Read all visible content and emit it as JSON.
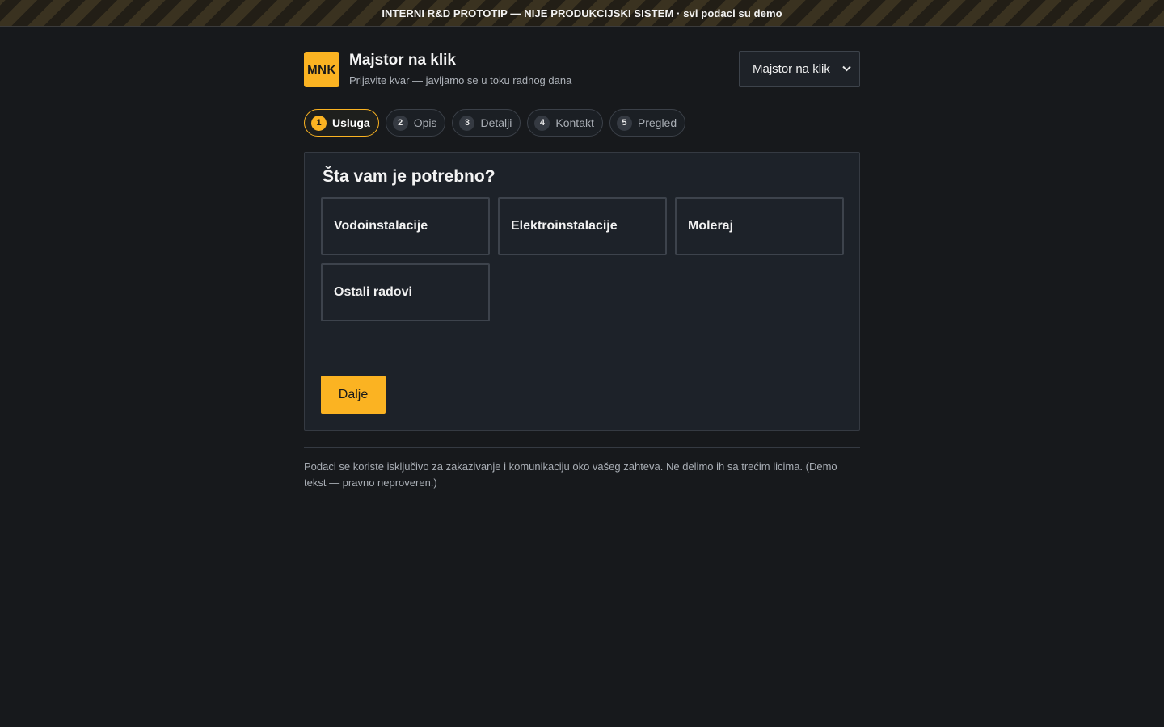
{
  "banner": {
    "text": "INTERNI R&D PROTOTIP — NIJE PRODUKCIJSKI SISTEM · svi podaci su demo"
  },
  "brand": {
    "logo_text": "MNK",
    "title": "Majstor na klik",
    "subtitle": "Prijavite kvar — javljamo se u toku radnog dana"
  },
  "brand_select": {
    "selected": "Majstor na klik",
    "chevron": "⌄"
  },
  "steps": [
    {
      "num": "1",
      "label": "Usluga",
      "active": true
    },
    {
      "num": "2",
      "label": "Opis",
      "active": false
    },
    {
      "num": "3",
      "label": "Detalji",
      "active": false
    },
    {
      "num": "4",
      "label": "Kontakt",
      "active": false
    },
    {
      "num": "5",
      "label": "Pregled",
      "active": false
    }
  ],
  "card": {
    "title": "Šta vam je potrebno?",
    "options": [
      "Vodoinstalacije",
      "Elektroinstalacije",
      "Moleraj",
      "Ostali radovi"
    ],
    "next_label": "Dalje"
  },
  "footer_note": "Podaci se koriste isključivo za zakazivanje i komunikaciju oko vašeg zahteva. Ne delimo ih sa trećim licima. (Demo tekst — pravno neproveren.)",
  "colors": {
    "accent": "#fbb322",
    "background": "#17191c",
    "card": "#1d2229"
  }
}
